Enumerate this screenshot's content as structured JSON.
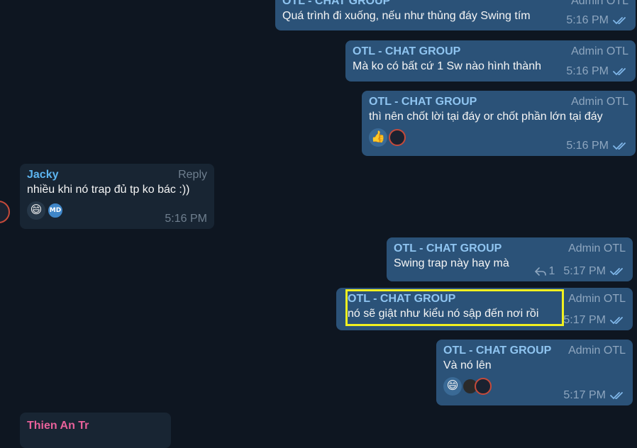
{
  "messages": [
    {
      "id": "m1",
      "sender": "OTL - CHAT GROUP",
      "tag": "Admin OTL",
      "text": "Quá trình đi xuống, nếu như thủng đáy Swing tím",
      "time": "5:16 PM"
    },
    {
      "id": "m2",
      "sender": "OTL - CHAT GROUP",
      "tag": "Admin OTL",
      "text": "Mà ko có bất cứ 1 Sw nào hình thành",
      "time": "5:16 PM"
    },
    {
      "id": "m3",
      "sender": "OTL - CHAT GROUP",
      "tag": "Admin OTL",
      "text": "thì nên chốt lời tại đáy or chốt phần lớn tại đáy",
      "time": "5:16 PM",
      "reactions": [
        "👍"
      ]
    },
    {
      "id": "m4",
      "sender": "Jacky",
      "tag": "Reply",
      "text": "nhiều khi nó trap đủ tp ko bác :))",
      "time": "5:16 PM",
      "reactions": [
        "😄"
      ],
      "avatar_initials": "MD"
    },
    {
      "id": "m5",
      "sender": "OTL - CHAT GROUP",
      "tag": "Admin OTL",
      "text": "Swing trap này hay mà",
      "time": "5:17 PM",
      "reply_count": "1"
    },
    {
      "id": "m6",
      "sender": "OTL - CHAT GROUP",
      "tag": "Admin OTL",
      "text": "nó sẽ giật như kiểu nó sập đến nơi rồi",
      "time": "5:17 PM"
    },
    {
      "id": "m7",
      "sender": "OTL - CHAT GROUP",
      "tag": "Admin OTL",
      "text": "Và nó lên",
      "time": "5:17 PM",
      "reactions": [
        "😄"
      ]
    },
    {
      "id": "m8",
      "sender": "Thien An Tr"
    }
  ],
  "colors": {
    "background": "#0e1621",
    "outgoing": "#2b5278",
    "incoming": "#182533",
    "highlight": "#f0f020"
  },
  "icons": {
    "read": "double-check-icon",
    "reply": "reply-arrow-icon"
  }
}
